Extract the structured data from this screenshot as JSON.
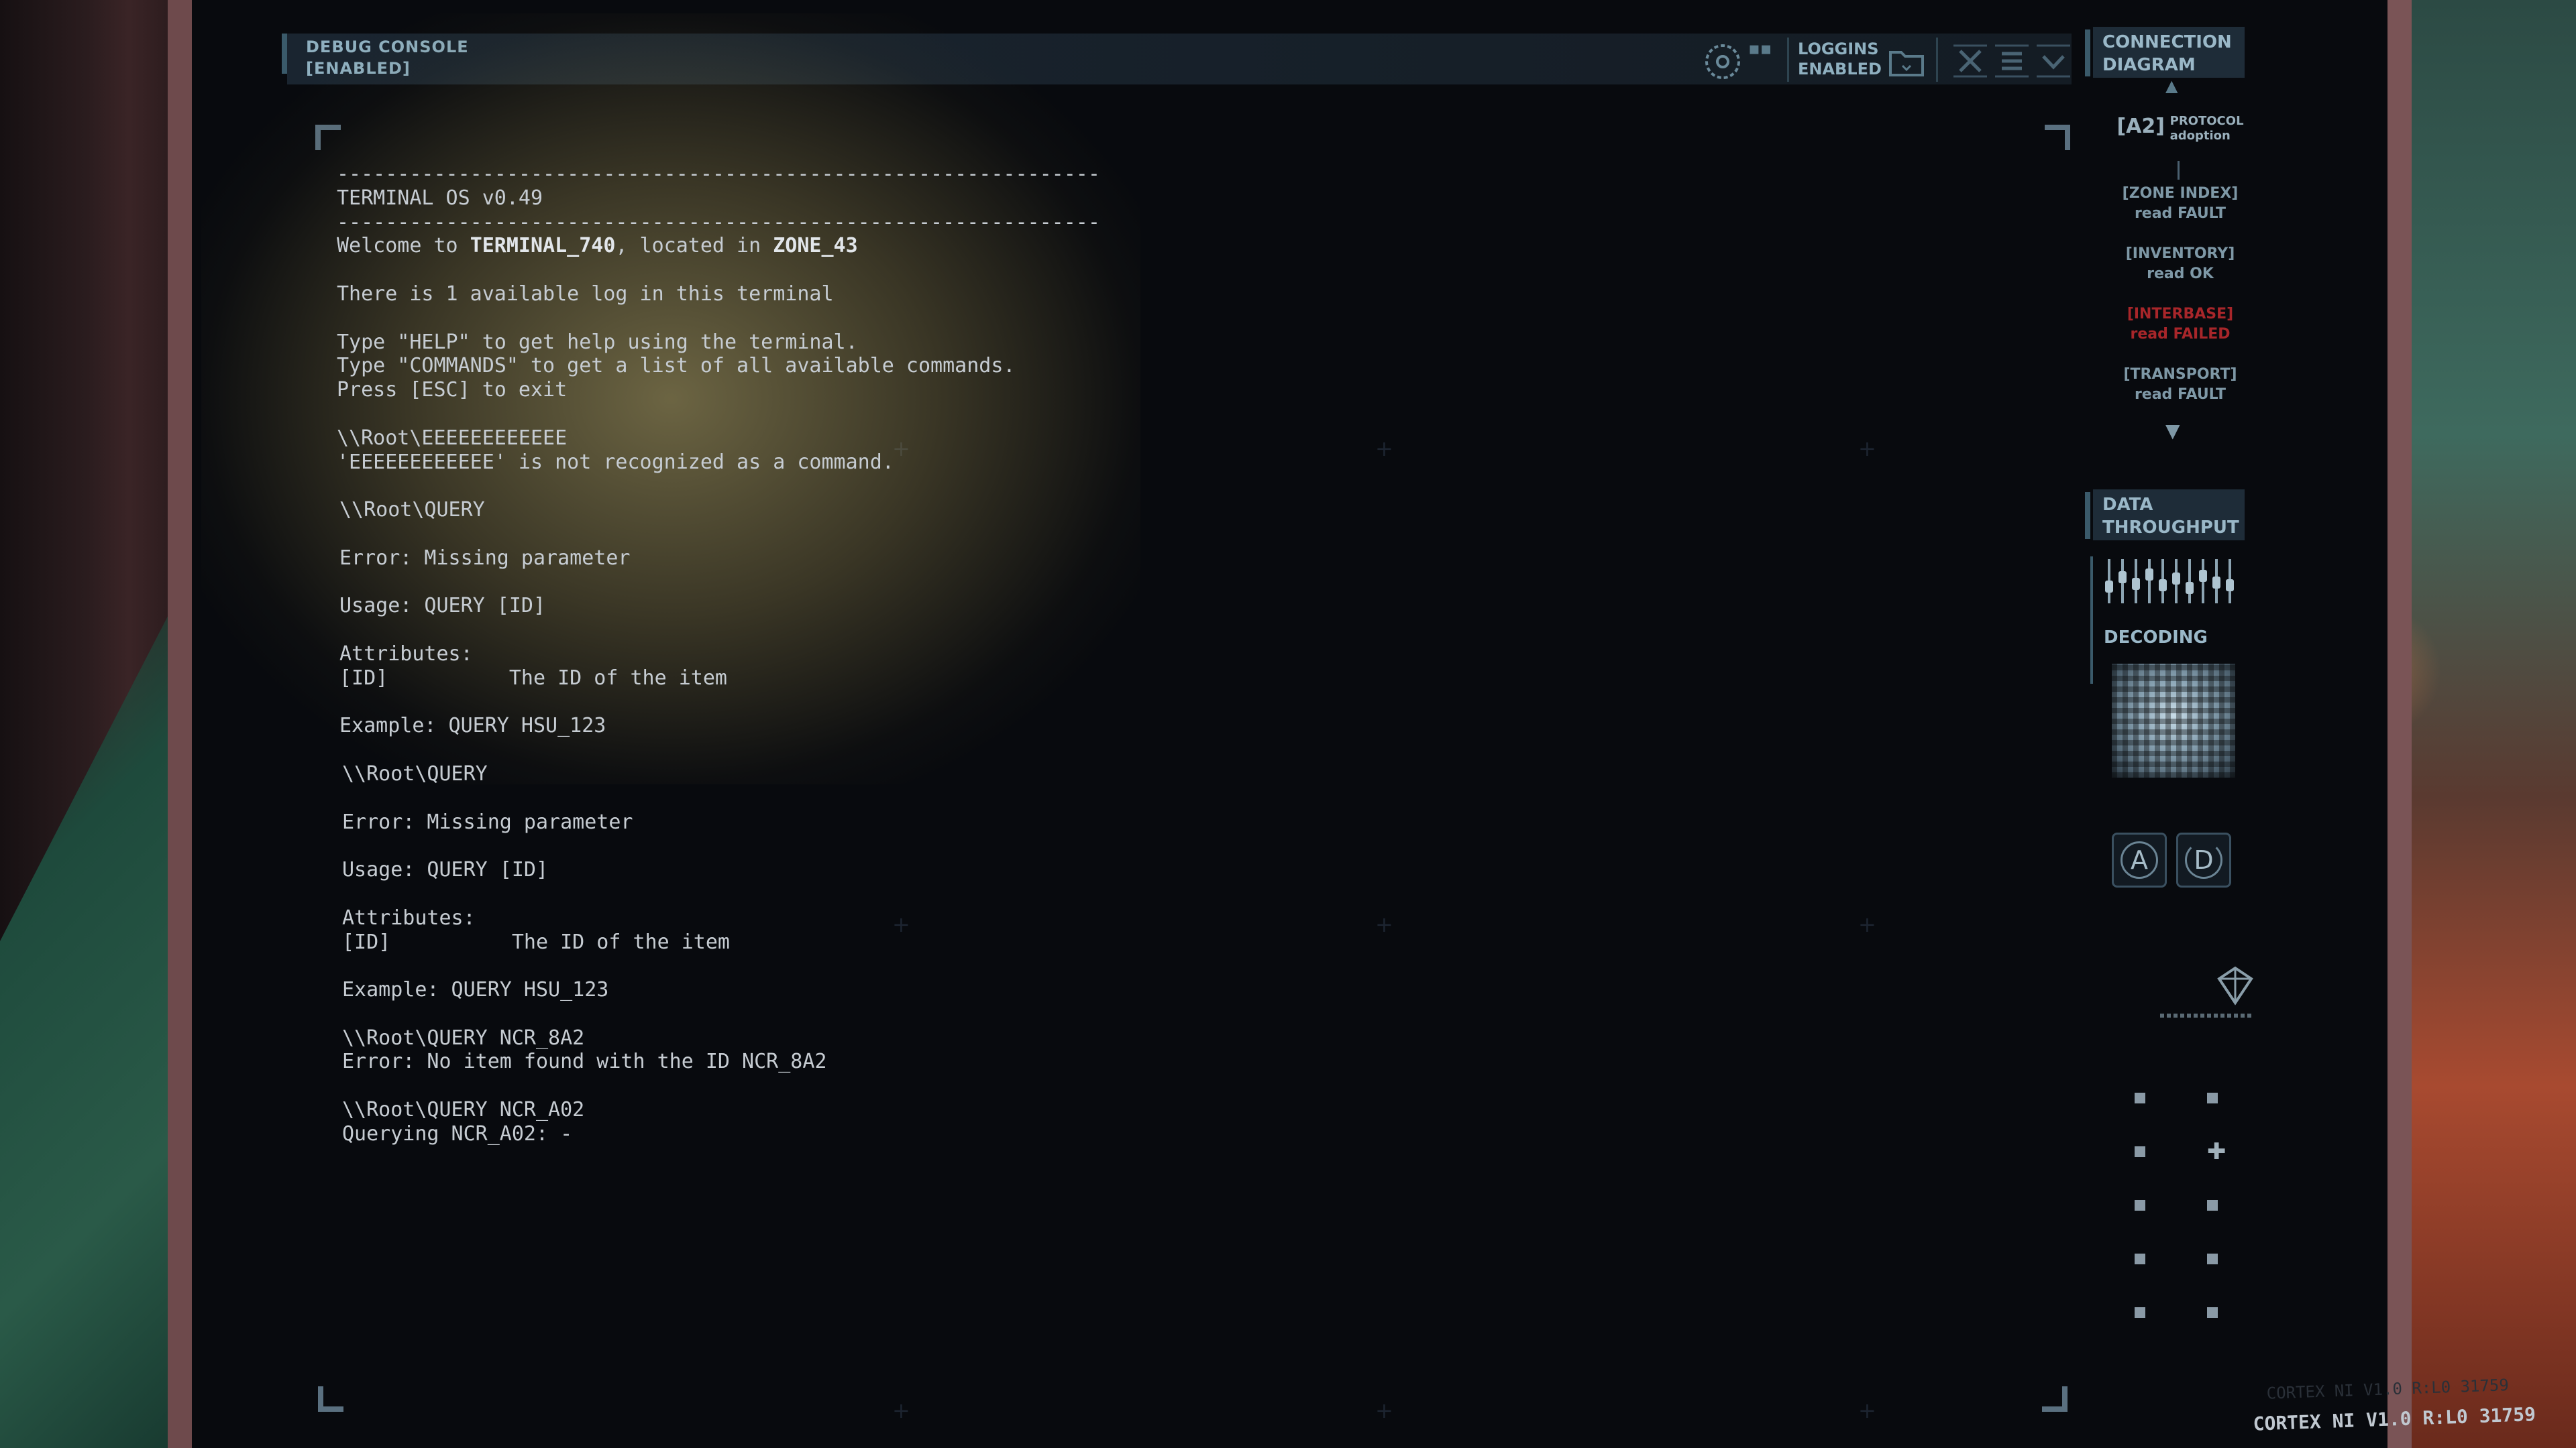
{
  "topbar": {
    "console_title": "DEBUG CONSOLE",
    "console_status": "[ENABLED]",
    "logging_line1": "LOGGINS",
    "logging_line2": "ENABLED"
  },
  "terminal": {
    "lines": [
      {
        "text": "---------------------------------------------------------------"
      },
      {
        "text": "TERMINAL OS v0.49"
      },
      {
        "text": "---------------------------------------------------------------"
      },
      {
        "pre": "Welcome to ",
        "bold1": "TERMINAL_740",
        "mid": ", located in ",
        "bold2": "ZONE_43"
      },
      {
        "text": ""
      },
      {
        "text": "There is 1 available log in this terminal"
      },
      {
        "text": ""
      },
      {
        "text": "Type \"HELP\" to get help using the terminal."
      },
      {
        "text": "Type \"COMMANDS\" to get a list of all available commands."
      },
      {
        "text": "Press [ESC] to exit"
      },
      {
        "text": ""
      },
      {
        "text": "\\\\Root\\EEEEEEEEEEEE"
      },
      {
        "text": "'EEEEEEEEEEEE' is not recognized as a command."
      },
      {
        "text": ""
      },
      {
        "text": "\\\\Root\\QUERY"
      },
      {
        "text": ""
      },
      {
        "text": "Error: Missing parameter"
      },
      {
        "text": ""
      },
      {
        "text": "Usage: QUERY [ID]"
      },
      {
        "text": ""
      },
      {
        "text": "Attributes:"
      },
      {
        "text": "[ID]          The ID of the item"
      },
      {
        "text": ""
      },
      {
        "text": "Example: QUERY HSU_123"
      },
      {
        "text": ""
      },
      {
        "text": "\\\\Root\\QUERY"
      },
      {
        "text": ""
      },
      {
        "text": "Error: Missing parameter"
      },
      {
        "text": ""
      },
      {
        "text": "Usage: QUERY [ID]"
      },
      {
        "text": ""
      },
      {
        "text": "Attributes:"
      },
      {
        "text": "[ID]          The ID of the item"
      },
      {
        "text": ""
      },
      {
        "text": "Example: QUERY HSU_123"
      },
      {
        "text": ""
      },
      {
        "text": "\\\\Root\\QUERY NCR_8A2"
      },
      {
        "text": "Error: No item found with the ID NCR_8A2"
      },
      {
        "text": ""
      },
      {
        "text": "\\\\Root\\QUERY NCR_A02"
      },
      {
        "text": "Querying NCR_A02: -"
      }
    ]
  },
  "right_panel": {
    "connection_title_1": "CONNECTION",
    "connection_title_2": "DIAGRAM",
    "protocol_code": "[A2]",
    "protocol_line1": "PROTOCOL",
    "protocol_line2": "adoption",
    "nodes": [
      {
        "name": "[ZONE INDEX]",
        "status": "read FAULT",
        "state": "ok"
      },
      {
        "name": "[INVENTORY]",
        "status": "read OK",
        "state": "ok"
      },
      {
        "name": "[INTERBASE]",
        "status": "read FAILED",
        "state": "fail"
      },
      {
        "name": "[TRANSPORT]",
        "status": "read FAULT",
        "state": "ok"
      }
    ],
    "throughput_title_1": "DATA",
    "throughput_title_2": "THROUGHPUT",
    "decoding_title": "DECODING",
    "btn_a": "A",
    "btn_d": "D"
  },
  "footer": {
    "version": "CORTEX NI V1.0 R:L0 31759"
  },
  "colors": {
    "accent": "#9ab8c8",
    "fail": "#a8262a",
    "text": "#c6ccd2"
  }
}
